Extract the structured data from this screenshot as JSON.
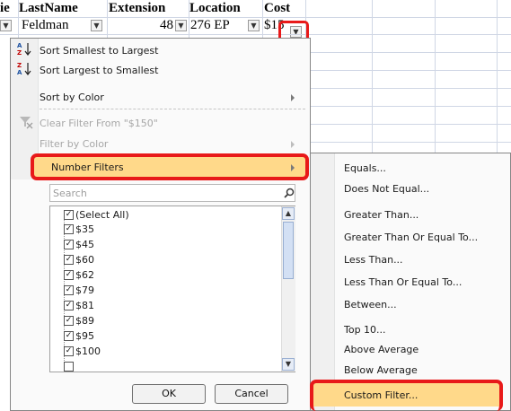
{
  "sheet": {
    "headers": [
      "ie",
      "LastName",
      "Extension",
      "Location",
      "Cost"
    ],
    "row": {
      "lastname": "Feldman",
      "extension": "48",
      "location": "276 EP",
      "cost": "$15"
    }
  },
  "menu": {
    "sort_asc": "Sort Smallest to Largest",
    "sort_desc": "Sort Largest to Smallest",
    "sort_color": "Sort by Color",
    "clear_filter": "Clear Filter From \"$150\"",
    "filter_color": "Filter by Color",
    "number_filters": "Number Filters",
    "search_placeholder": "Search",
    "select_all": "(Select All)",
    "values": [
      "$35",
      "$45",
      "$60",
      "$62",
      "$79",
      "$81",
      "$89",
      "$95",
      "$100"
    ],
    "ok": "OK",
    "cancel": "Cancel"
  },
  "submenu": {
    "items": [
      "Equals...",
      "Does Not Equal...",
      "Greater Than...",
      "Greater Than Or Equal To...",
      "Less Than...",
      "Less Than Or Equal To...",
      "Between...",
      "Top 10...",
      "Above Average",
      "Below Average",
      "Custom Filter..."
    ]
  },
  "colors": {
    "highlight": "#ffd98a",
    "annotation": "#e81919"
  }
}
